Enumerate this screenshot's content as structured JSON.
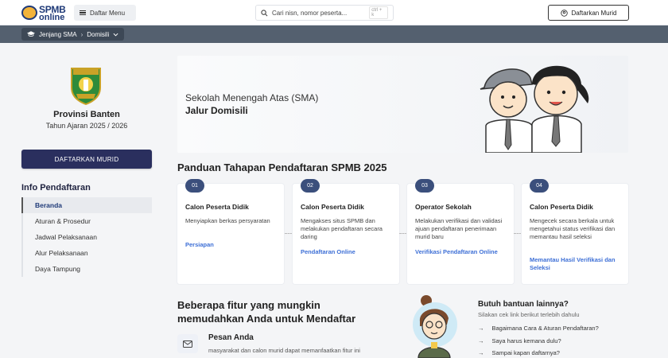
{
  "header": {
    "logo_line1": "SPMB",
    "logo_line2": "online",
    "menu_label": "Daftar Menu",
    "search_placeholder": "Cari nisn, nomor peserta...",
    "search_shortcut": "ctrl + k",
    "register_label": "Daftarkan Murid"
  },
  "breadcrumb": {
    "level": "Jenjang SMA",
    "path": "Domisili"
  },
  "sidebar": {
    "province": "Provinsi Banten",
    "year": "Tahun Ajaran 2025 / 2026",
    "register_button": "DAFTARKAN MURID",
    "info_title": "Info Pendaftaran",
    "items": [
      {
        "label": "Beranda",
        "active": true
      },
      {
        "label": "Aturan & Prosedur"
      },
      {
        "label": "Jadwal Pelaksanaan"
      },
      {
        "label": "Alur Pelaksanaan"
      },
      {
        "label": "Daya Tampung"
      }
    ],
    "crest_text": "BANTEN",
    "crest_motto": "IMAN TAQWA"
  },
  "hero": {
    "subtitle": "Sekolah Menengah Atas (SMA)",
    "title": "Jalur Domisili"
  },
  "guide": {
    "title": "Panduan Tahapan Pendaftaran SPMB 2025",
    "steps": [
      {
        "num": "01",
        "title": "Calon Peserta Didik",
        "desc": "Menyiapkan berkas persyaratan",
        "link": "Persiapan"
      },
      {
        "num": "02",
        "title": "Calon Peserta Didik",
        "desc": "Mengakses situs SPMB dan melakukan pendaftaran secara daring",
        "link": "Pendaftaran Online"
      },
      {
        "num": "03",
        "title": "Operator Sekolah",
        "desc": "Melakukan verifikasi dan validasi ajuan pendaftaran penerimaan murid baru",
        "link": "Verifikasi Pendaftaran Online"
      },
      {
        "num": "04",
        "title": "Calon Peserta Didik",
        "desc": "Mengecek secara berkala untuk mengetahui status verifikasi dan memantau hasil seleksi",
        "link": "Memantau Hasil Verifikasi dan Seleksi"
      }
    ]
  },
  "features": {
    "title": "Beberapa fitur yang mungkin memudahkan Anda untuk Mendaftar",
    "item_title": "Pesan Anda",
    "item_desc": "masyarakat dan calon murid dapat memanfaatkan fitur ini"
  },
  "help": {
    "title": "Butuh bantuan lainnya?",
    "subtitle": "Silakan cek link berikut terlebih dahulu",
    "links": [
      "Bagaimana Cara & Aturan Pendaftaran?",
      "Saya harus kemana dulu?",
      "Sampai kapan daftarnya?"
    ]
  },
  "colors": {
    "primary": "#2a2f5e",
    "link": "#3d6fd6",
    "navbar": "#54606f"
  }
}
